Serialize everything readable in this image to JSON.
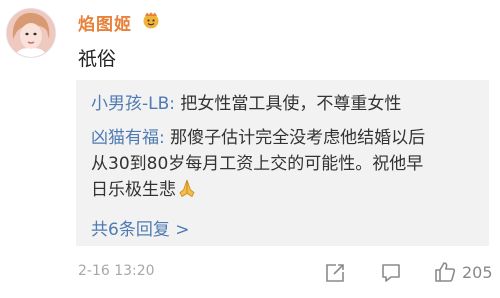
{
  "user": {
    "name": "焰图姬",
    "badge_icon": "crown-face-emoji-icon",
    "avatar_icon": "user-avatar-photo"
  },
  "comment": {
    "text": "祇俗"
  },
  "replies": [
    {
      "author": "小男孩-LB:",
      "text": " 把女性當工具使，不尊重女性"
    },
    {
      "author": "凶猫有福:",
      "text_line1": " 那傻子估计完全没考虑他结婚以后",
      "text_line2": "从30到80岁每月工资上交的可能性。祝他早",
      "text_line3": "日乐极生悲",
      "emoji_icon": "praying-hands-emoji-icon"
    }
  ],
  "more_replies": "共6条回复 >",
  "footer": {
    "timestamp": "2-16 13:20",
    "share_icon": "share-icon",
    "comment_icon": "comment-icon",
    "like_icon": "thumbs-up-icon",
    "like_count": "205"
  },
  "colors": {
    "username": "#e8823a",
    "link": "#4f7bb2",
    "reply_bg": "#f2f2f2",
    "meta": "#a8a8a8"
  }
}
